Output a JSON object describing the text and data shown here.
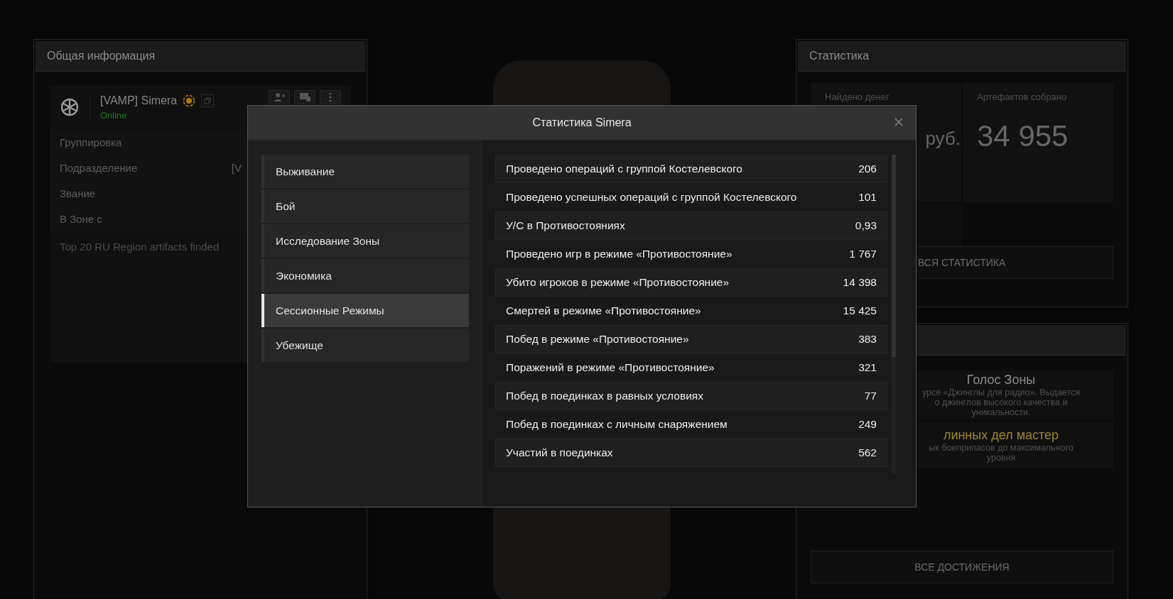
{
  "left_panel": {
    "title": "Общая информация",
    "player": {
      "name": "[VAMP] Simera",
      "status": "Online"
    },
    "rows": [
      {
        "label": "Группировка"
      },
      {
        "label": "Подразделение",
        "value": "[V"
      },
      {
        "label": "Звание"
      },
      {
        "label": "В Зоне с"
      }
    ],
    "note": "Top 20 RU Region artifacts finded"
  },
  "stats_panel": {
    "title": "Статистика",
    "cells": [
      {
        "label": "Найдено денег",
        "value": "руб."
      },
      {
        "label": "Артефактов собрано",
        "value": "34 955"
      }
    ],
    "button": "ВСЯ СТАТИСТИКА"
  },
  "achievements_panel": {
    "items": [
      {
        "title": "Голос Зоны",
        "color": "#8c8c8c",
        "lines": [
          "урсе «Джинглы для радио». Выдается",
          "о джинглов высокого качества и",
          "уникальности."
        ]
      },
      {
        "title": "линных дел мастер",
        "color": "#9c8535",
        "lines": [
          "ык боеприпасов до максимального",
          "уровня"
        ]
      }
    ],
    "button": "ВСЕ ДОСТИЖЕНИЯ"
  },
  "modal": {
    "title": "Статистика Simera",
    "categories": [
      {
        "label": "Выживание",
        "selected": false
      },
      {
        "label": "Бой",
        "selected": false
      },
      {
        "label": "Исследование Зоны",
        "selected": false
      },
      {
        "label": "Экономика",
        "selected": false
      },
      {
        "label": "Сессионные Режимы",
        "selected": true
      },
      {
        "label": "Убежище",
        "selected": false
      }
    ],
    "rows": [
      {
        "label": "Проведено операций с группой Костелевского",
        "value": "206"
      },
      {
        "label": "Проведено успешных операций с группой Костелевского",
        "value": "101"
      },
      {
        "label": "У/С в Противостояниях",
        "value": "0,93"
      },
      {
        "label": "Проведено игр в режиме «Противостояние»",
        "value": "1 767"
      },
      {
        "label": "Убито игроков в режиме «Противостояние»",
        "value": "14 398"
      },
      {
        "label": "Смертей в режиме «Противостояние»",
        "value": "15 425"
      },
      {
        "label": "Побед в режиме «Противостояние»",
        "value": "383"
      },
      {
        "label": "Поражений в режиме «Противостояние»",
        "value": "321"
      },
      {
        "label": "Побед в поединках в равных условиях",
        "value": "77"
      },
      {
        "label": "Побед в поединках с личным снаряжением",
        "value": "249"
      },
      {
        "label": "Участий в поединках",
        "value": "562"
      }
    ]
  }
}
